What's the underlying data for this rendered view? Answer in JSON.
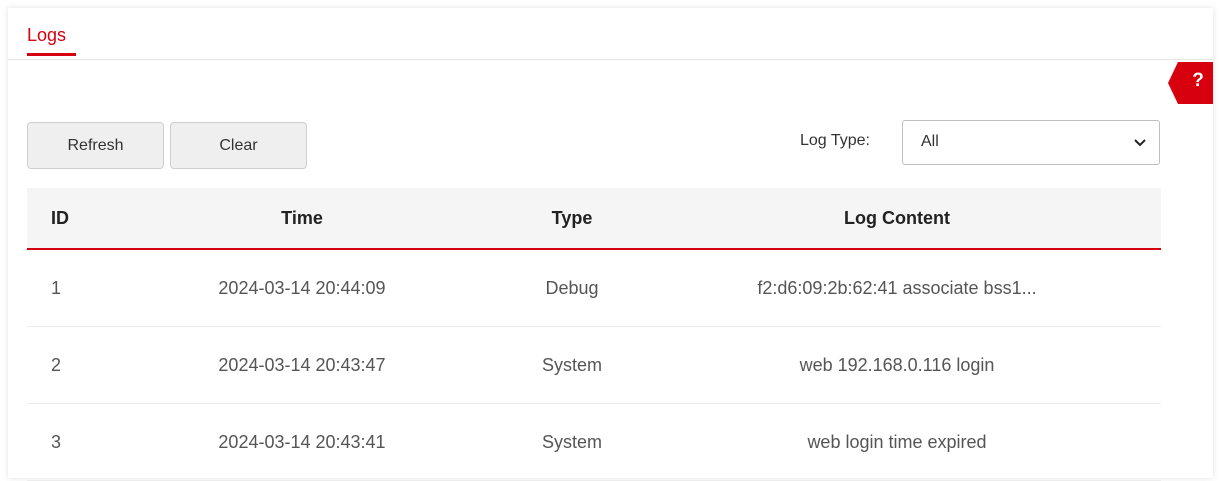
{
  "tabs": {
    "active_label": "Logs"
  },
  "help": {
    "icon": "help-icon",
    "mark": "?"
  },
  "toolbar": {
    "refresh_label": "Refresh",
    "clear_label": "Clear"
  },
  "filter": {
    "label": "Log Type:",
    "selected": "All"
  },
  "table": {
    "headers": [
      "ID",
      "Time",
      "Type",
      "Log Content"
    ],
    "rows": [
      [
        "1",
        "2024-03-14 20:44:09",
        "Debug",
        "f2:d6:09:2b:62:41 associate bss1..."
      ],
      [
        "2",
        "2024-03-14 20:43:47",
        "System",
        "web 192.168.0.116 login"
      ],
      [
        "3",
        "2024-03-14 20:43:41",
        "System",
        "web login time expired"
      ]
    ]
  },
  "colors": {
    "accent": "#d7000f"
  }
}
